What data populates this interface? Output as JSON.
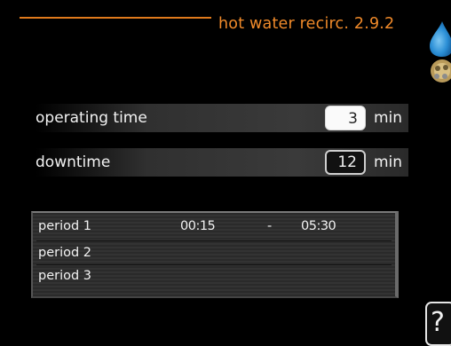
{
  "header": {
    "title": "hot water recirc. 2.9.2"
  },
  "icons": {
    "menu_icon": "water-drop-icon",
    "secondary_icon": "heating-icon",
    "accent_color": "#f08a2a",
    "drop_color": "#2b8fd6"
  },
  "settings": [
    {
      "label": "operating time",
      "value": "3",
      "unit": "min",
      "selected": true
    },
    {
      "label": "downtime",
      "value": "12",
      "unit": "min",
      "selected": false
    }
  ],
  "periods": [
    {
      "label": "period 1",
      "start": "00:15",
      "dash": "-",
      "end": "05:30"
    },
    {
      "label": "period 2",
      "start": "",
      "dash": "",
      "end": ""
    },
    {
      "label": "period 3",
      "start": "",
      "dash": "",
      "end": ""
    }
  ],
  "help": {
    "label": "?"
  }
}
